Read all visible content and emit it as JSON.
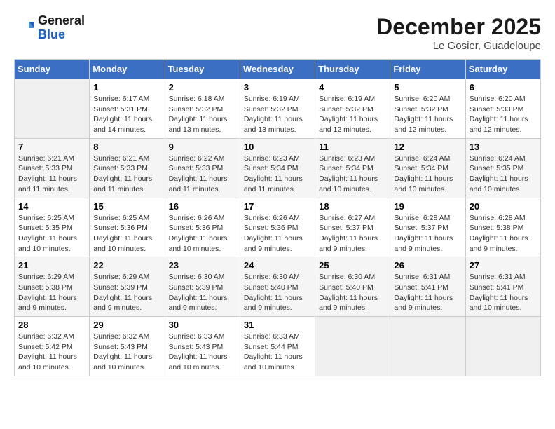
{
  "header": {
    "logo_general": "General",
    "logo_blue": "Blue",
    "month_title": "December 2025",
    "location": "Le Gosier, Guadeloupe"
  },
  "days_of_week": [
    "Sunday",
    "Monday",
    "Tuesday",
    "Wednesday",
    "Thursday",
    "Friday",
    "Saturday"
  ],
  "weeks": [
    [
      {
        "day": "",
        "sunrise": "",
        "sunset": "",
        "daylight": ""
      },
      {
        "day": "1",
        "sunrise": "Sunrise: 6:17 AM",
        "sunset": "Sunset: 5:31 PM",
        "daylight": "Daylight: 11 hours and 14 minutes."
      },
      {
        "day": "2",
        "sunrise": "Sunrise: 6:18 AM",
        "sunset": "Sunset: 5:32 PM",
        "daylight": "Daylight: 11 hours and 13 minutes."
      },
      {
        "day": "3",
        "sunrise": "Sunrise: 6:19 AM",
        "sunset": "Sunset: 5:32 PM",
        "daylight": "Daylight: 11 hours and 13 minutes."
      },
      {
        "day": "4",
        "sunrise": "Sunrise: 6:19 AM",
        "sunset": "Sunset: 5:32 PM",
        "daylight": "Daylight: 11 hours and 12 minutes."
      },
      {
        "day": "5",
        "sunrise": "Sunrise: 6:20 AM",
        "sunset": "Sunset: 5:32 PM",
        "daylight": "Daylight: 11 hours and 12 minutes."
      },
      {
        "day": "6",
        "sunrise": "Sunrise: 6:20 AM",
        "sunset": "Sunset: 5:33 PM",
        "daylight": "Daylight: 11 hours and 12 minutes."
      }
    ],
    [
      {
        "day": "7",
        "sunrise": "Sunrise: 6:21 AM",
        "sunset": "Sunset: 5:33 PM",
        "daylight": "Daylight: 11 hours and 11 minutes."
      },
      {
        "day": "8",
        "sunrise": "Sunrise: 6:21 AM",
        "sunset": "Sunset: 5:33 PM",
        "daylight": "Daylight: 11 hours and 11 minutes."
      },
      {
        "day": "9",
        "sunrise": "Sunrise: 6:22 AM",
        "sunset": "Sunset: 5:33 PM",
        "daylight": "Daylight: 11 hours and 11 minutes."
      },
      {
        "day": "10",
        "sunrise": "Sunrise: 6:23 AM",
        "sunset": "Sunset: 5:34 PM",
        "daylight": "Daylight: 11 hours and 11 minutes."
      },
      {
        "day": "11",
        "sunrise": "Sunrise: 6:23 AM",
        "sunset": "Sunset: 5:34 PM",
        "daylight": "Daylight: 11 hours and 10 minutes."
      },
      {
        "day": "12",
        "sunrise": "Sunrise: 6:24 AM",
        "sunset": "Sunset: 5:34 PM",
        "daylight": "Daylight: 11 hours and 10 minutes."
      },
      {
        "day": "13",
        "sunrise": "Sunrise: 6:24 AM",
        "sunset": "Sunset: 5:35 PM",
        "daylight": "Daylight: 11 hours and 10 minutes."
      }
    ],
    [
      {
        "day": "14",
        "sunrise": "Sunrise: 6:25 AM",
        "sunset": "Sunset: 5:35 PM",
        "daylight": "Daylight: 11 hours and 10 minutes."
      },
      {
        "day": "15",
        "sunrise": "Sunrise: 6:25 AM",
        "sunset": "Sunset: 5:36 PM",
        "daylight": "Daylight: 11 hours and 10 minutes."
      },
      {
        "day": "16",
        "sunrise": "Sunrise: 6:26 AM",
        "sunset": "Sunset: 5:36 PM",
        "daylight": "Daylight: 11 hours and 10 minutes."
      },
      {
        "day": "17",
        "sunrise": "Sunrise: 6:26 AM",
        "sunset": "Sunset: 5:36 PM",
        "daylight": "Daylight: 11 hours and 9 minutes."
      },
      {
        "day": "18",
        "sunrise": "Sunrise: 6:27 AM",
        "sunset": "Sunset: 5:37 PM",
        "daylight": "Daylight: 11 hours and 9 minutes."
      },
      {
        "day": "19",
        "sunrise": "Sunrise: 6:28 AM",
        "sunset": "Sunset: 5:37 PM",
        "daylight": "Daylight: 11 hours and 9 minutes."
      },
      {
        "day": "20",
        "sunrise": "Sunrise: 6:28 AM",
        "sunset": "Sunset: 5:38 PM",
        "daylight": "Daylight: 11 hours and 9 minutes."
      }
    ],
    [
      {
        "day": "21",
        "sunrise": "Sunrise: 6:29 AM",
        "sunset": "Sunset: 5:38 PM",
        "daylight": "Daylight: 11 hours and 9 minutes."
      },
      {
        "day": "22",
        "sunrise": "Sunrise: 6:29 AM",
        "sunset": "Sunset: 5:39 PM",
        "daylight": "Daylight: 11 hours and 9 minutes."
      },
      {
        "day": "23",
        "sunrise": "Sunrise: 6:30 AM",
        "sunset": "Sunset: 5:39 PM",
        "daylight": "Daylight: 11 hours and 9 minutes."
      },
      {
        "day": "24",
        "sunrise": "Sunrise: 6:30 AM",
        "sunset": "Sunset: 5:40 PM",
        "daylight": "Daylight: 11 hours and 9 minutes."
      },
      {
        "day": "25",
        "sunrise": "Sunrise: 6:30 AM",
        "sunset": "Sunset: 5:40 PM",
        "daylight": "Daylight: 11 hours and 9 minutes."
      },
      {
        "day": "26",
        "sunrise": "Sunrise: 6:31 AM",
        "sunset": "Sunset: 5:41 PM",
        "daylight": "Daylight: 11 hours and 9 minutes."
      },
      {
        "day": "27",
        "sunrise": "Sunrise: 6:31 AM",
        "sunset": "Sunset: 5:41 PM",
        "daylight": "Daylight: 11 hours and 10 minutes."
      }
    ],
    [
      {
        "day": "28",
        "sunrise": "Sunrise: 6:32 AM",
        "sunset": "Sunset: 5:42 PM",
        "daylight": "Daylight: 11 hours and 10 minutes."
      },
      {
        "day": "29",
        "sunrise": "Sunrise: 6:32 AM",
        "sunset": "Sunset: 5:43 PM",
        "daylight": "Daylight: 11 hours and 10 minutes."
      },
      {
        "day": "30",
        "sunrise": "Sunrise: 6:33 AM",
        "sunset": "Sunset: 5:43 PM",
        "daylight": "Daylight: 11 hours and 10 minutes."
      },
      {
        "day": "31",
        "sunrise": "Sunrise: 6:33 AM",
        "sunset": "Sunset: 5:44 PM",
        "daylight": "Daylight: 11 hours and 10 minutes."
      },
      {
        "day": "",
        "sunrise": "",
        "sunset": "",
        "daylight": ""
      },
      {
        "day": "",
        "sunrise": "",
        "sunset": "",
        "daylight": ""
      },
      {
        "day": "",
        "sunrise": "",
        "sunset": "",
        "daylight": ""
      }
    ]
  ]
}
